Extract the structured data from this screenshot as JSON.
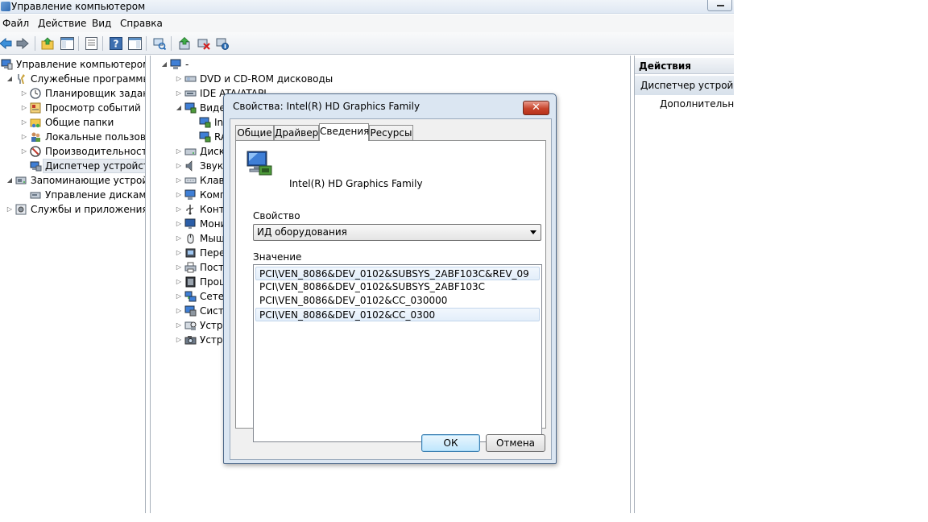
{
  "window": {
    "title": "Управление компьютером"
  },
  "menu": [
    "Файл",
    "Действие",
    "Вид",
    "Справка"
  ],
  "toolbar": {
    "icons": [
      "back-arrow-icon",
      "forward-arrow-icon",
      "up-folder-icon",
      "show-tree-icon",
      "properties-icon",
      "help-icon",
      "show-action-pane-icon",
      "scan-hardware-icon",
      "update-driver-icon",
      "uninstall-device-icon",
      "disable-device-icon"
    ]
  },
  "left_tree": [
    {
      "label": "Управление компьютером (л",
      "icon": "computer-management-icon",
      "arrow": "",
      "level": 0
    },
    {
      "label": "Служебные программы",
      "icon": "tools-icon",
      "arrow": "expanded",
      "level": 1
    },
    {
      "label": "Планировщик заданий",
      "icon": "clock-icon",
      "arrow": "collapsed",
      "level": 2
    },
    {
      "label": "Просмотр событий",
      "icon": "event-viewer-icon",
      "arrow": "collapsed",
      "level": 2
    },
    {
      "label": "Общие папки",
      "icon": "shared-folder-icon",
      "arrow": "collapsed",
      "level": 2
    },
    {
      "label": "Локальные пользовате",
      "icon": "users-icon",
      "arrow": "collapsed",
      "level": 2
    },
    {
      "label": "Производительность",
      "icon": "performance-icon",
      "arrow": "collapsed",
      "level": 2
    },
    {
      "label": "Диспетчер устройств",
      "icon": "device-manager-icon",
      "arrow": "",
      "level": 2,
      "selected": true
    },
    {
      "label": "Запоминающие устройст",
      "icon": "storage-icon",
      "arrow": "expanded",
      "level": 1
    },
    {
      "label": "Управление дисками",
      "icon": "disk-management-icon",
      "arrow": "",
      "level": 2
    },
    {
      "label": "Службы и приложения",
      "icon": "services-icon",
      "arrow": "collapsed",
      "level": 1
    }
  ],
  "device_tree": [
    {
      "label": "-",
      "icon": "computer-icon",
      "arrow": "expanded",
      "level": 0
    },
    {
      "label": "DVD и CD-ROM дисководы",
      "icon": "dvd-drive-icon",
      "arrow": "collapsed",
      "level": 1
    },
    {
      "label": "IDE ATA/ATAPI",
      "icon": "ide-controller-icon",
      "arrow": "collapsed",
      "level": 1
    },
    {
      "label": "Виде",
      "icon": "display-adapter-icon",
      "arrow": "expanded",
      "level": 1
    },
    {
      "label": "In",
      "icon": "display-adapter-icon",
      "arrow": "",
      "level": 2
    },
    {
      "label": "RA",
      "icon": "display-adapter-icon",
      "arrow": "",
      "level": 2
    },
    {
      "label": "Диск",
      "icon": "disk-drive-icon",
      "arrow": "collapsed",
      "level": 1
    },
    {
      "label": "Звук",
      "icon": "sound-icon",
      "arrow": "collapsed",
      "level": 1
    },
    {
      "label": "Клав",
      "icon": "keyboard-icon",
      "arrow": "collapsed",
      "level": 1
    },
    {
      "label": "Комп",
      "icon": "computer-icon",
      "arrow": "collapsed",
      "level": 1
    },
    {
      "label": "Конт",
      "icon": "usb-controller-icon",
      "arrow": "collapsed",
      "level": 1
    },
    {
      "label": "Мони",
      "icon": "monitor-icon",
      "arrow": "collapsed",
      "level": 1
    },
    {
      "label": "Мыш",
      "icon": "mouse-icon",
      "arrow": "collapsed",
      "level": 1
    },
    {
      "label": "Пере",
      "icon": "portable-device-icon",
      "arrow": "collapsed",
      "level": 1
    },
    {
      "label": "Пост",
      "icon": "printer-icon",
      "arrow": "collapsed",
      "level": 1
    },
    {
      "label": "Проц",
      "icon": "processor-icon",
      "arrow": "collapsed",
      "level": 1
    },
    {
      "label": "Сете",
      "icon": "network-adapter-icon",
      "arrow": "collapsed",
      "level": 1
    },
    {
      "label": "Систе",
      "icon": "system-device-icon",
      "arrow": "collapsed",
      "level": 1
    },
    {
      "label": "Устро",
      "icon": "hid-device-icon",
      "arrow": "collapsed",
      "level": 1
    },
    {
      "label": "Устро",
      "icon": "imaging-device-icon",
      "arrow": "collapsed",
      "level": 1
    }
  ],
  "actions": {
    "header": "Действия",
    "section": "Диспетчер устройств",
    "more": "Дополнительные"
  },
  "dialog": {
    "title": "Свойства: Intel(R) HD Graphics Family",
    "close_symbol": "✕",
    "tabs": [
      "Общие",
      "Драйвер",
      "Сведения",
      "Ресурсы"
    ],
    "active_tab": "Сведения",
    "device_name": "Intel(R) HD Graphics Family",
    "property_label": "Свойство",
    "property_value": "ИД оборудования",
    "value_label": "Значение",
    "values": [
      "PCI\\VEN_8086&DEV_0102&SUBSYS_2ABF103C&REV_09",
      "PCI\\VEN_8086&DEV_0102&SUBSYS_2ABF103C",
      "PCI\\VEN_8086&DEV_0102&CC_030000",
      "PCI\\VEN_8086&DEV_0102&CC_0300"
    ],
    "selected_values": [
      0,
      3
    ],
    "ok_label": "ОК",
    "cancel_label": "Отмена"
  },
  "colors": {
    "selection": "#e3eefa",
    "dialog_frame": "#dbe6f2",
    "close_button": "#c7442c"
  }
}
